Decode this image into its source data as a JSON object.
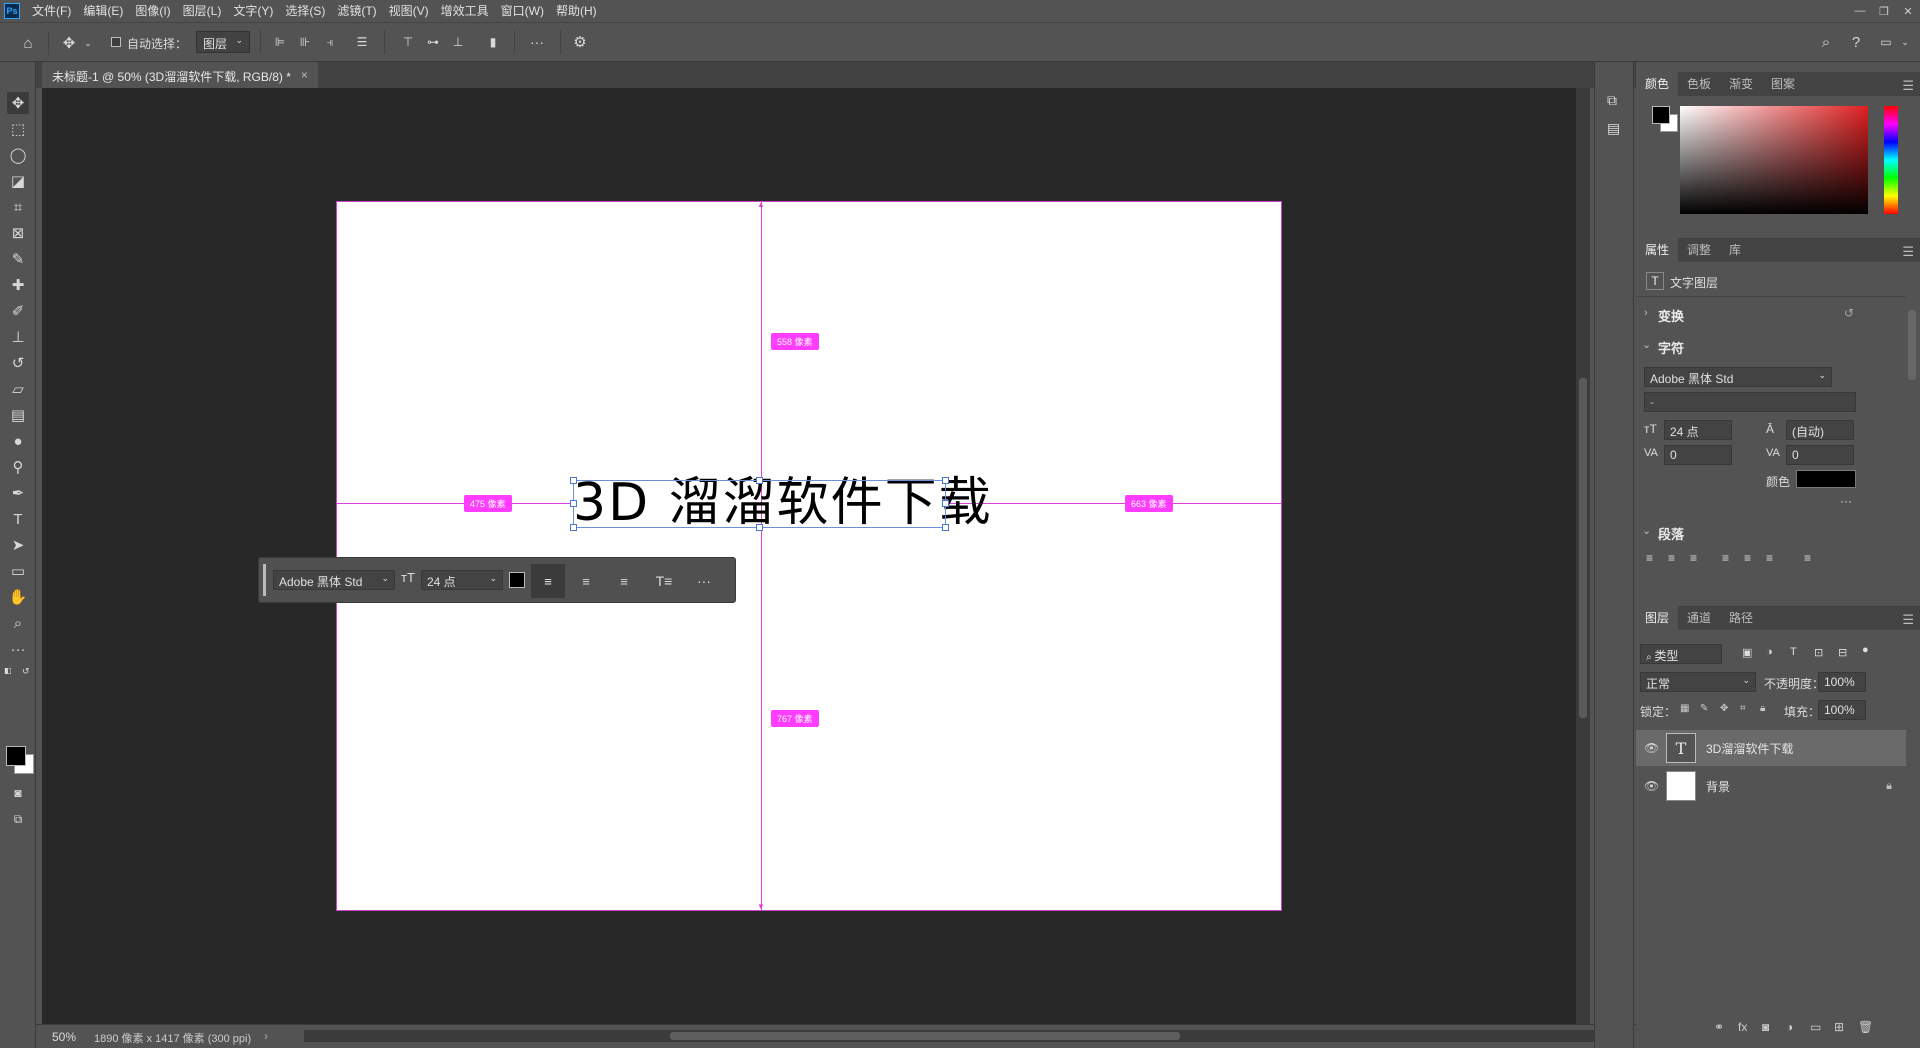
{
  "app": {
    "logo": "Ps"
  },
  "menu": [
    "文件(F)",
    "编辑(E)",
    "图像(I)",
    "图层(L)",
    "文字(Y)",
    "选择(S)",
    "滤镜(T)",
    "视图(V)",
    "增效工具",
    "窗口(W)",
    "帮助(H)"
  ],
  "options_bar": {
    "auto_select_label": "自动选择：",
    "auto_select_checked": false,
    "layer_select_value": "图层"
  },
  "document": {
    "tab_title": "未标题-1 @ 50% (3D溜溜软件下载, RGB/8) *",
    "canvas_text": "3D 溜溜软件下载",
    "measure_top": "558 像素",
    "measure_left": "475 像素",
    "measure_right": "663 像素",
    "measure_bottom": "767 像素"
  },
  "context_bar": {
    "font": "Adobe 黑体 Std",
    "size": "24 点",
    "more": "···"
  },
  "status": {
    "zoom": "50%",
    "doc_info": "1890 像素 x 1417 像素 (300 ppi)"
  },
  "panels": {
    "color": {
      "tabs": [
        "颜色",
        "色板",
        "渐变",
        "图案"
      ],
      "active": "颜色"
    },
    "properties": {
      "tabs": [
        "属性",
        "调整",
        "库"
      ],
      "layer_type": "文字图层",
      "section_transform": "变换",
      "section_character": "字符",
      "font_family": "Adobe 黑体 Std",
      "font_style": "-",
      "font_size": "24 点",
      "leading": "(自动)",
      "kerning": "0",
      "tracking": "0",
      "color_label": "颜色",
      "text_color": "#000000",
      "more": "···",
      "section_paragraph": "段落"
    },
    "layers": {
      "tabs": [
        "图层",
        "通道",
        "路径"
      ],
      "filter_kind": "类型",
      "blend_mode": "正常",
      "opacity_label": "不透明度：",
      "opacity": "100%",
      "lock_label": "锁定：",
      "fill_label": "填充：",
      "fill": "100%",
      "items": [
        {
          "name": "3D溜溜软件下载",
          "thumb": "T",
          "selected": true
        },
        {
          "name": "背景",
          "thumb": "",
          "selected": false,
          "locked": true
        }
      ]
    }
  }
}
